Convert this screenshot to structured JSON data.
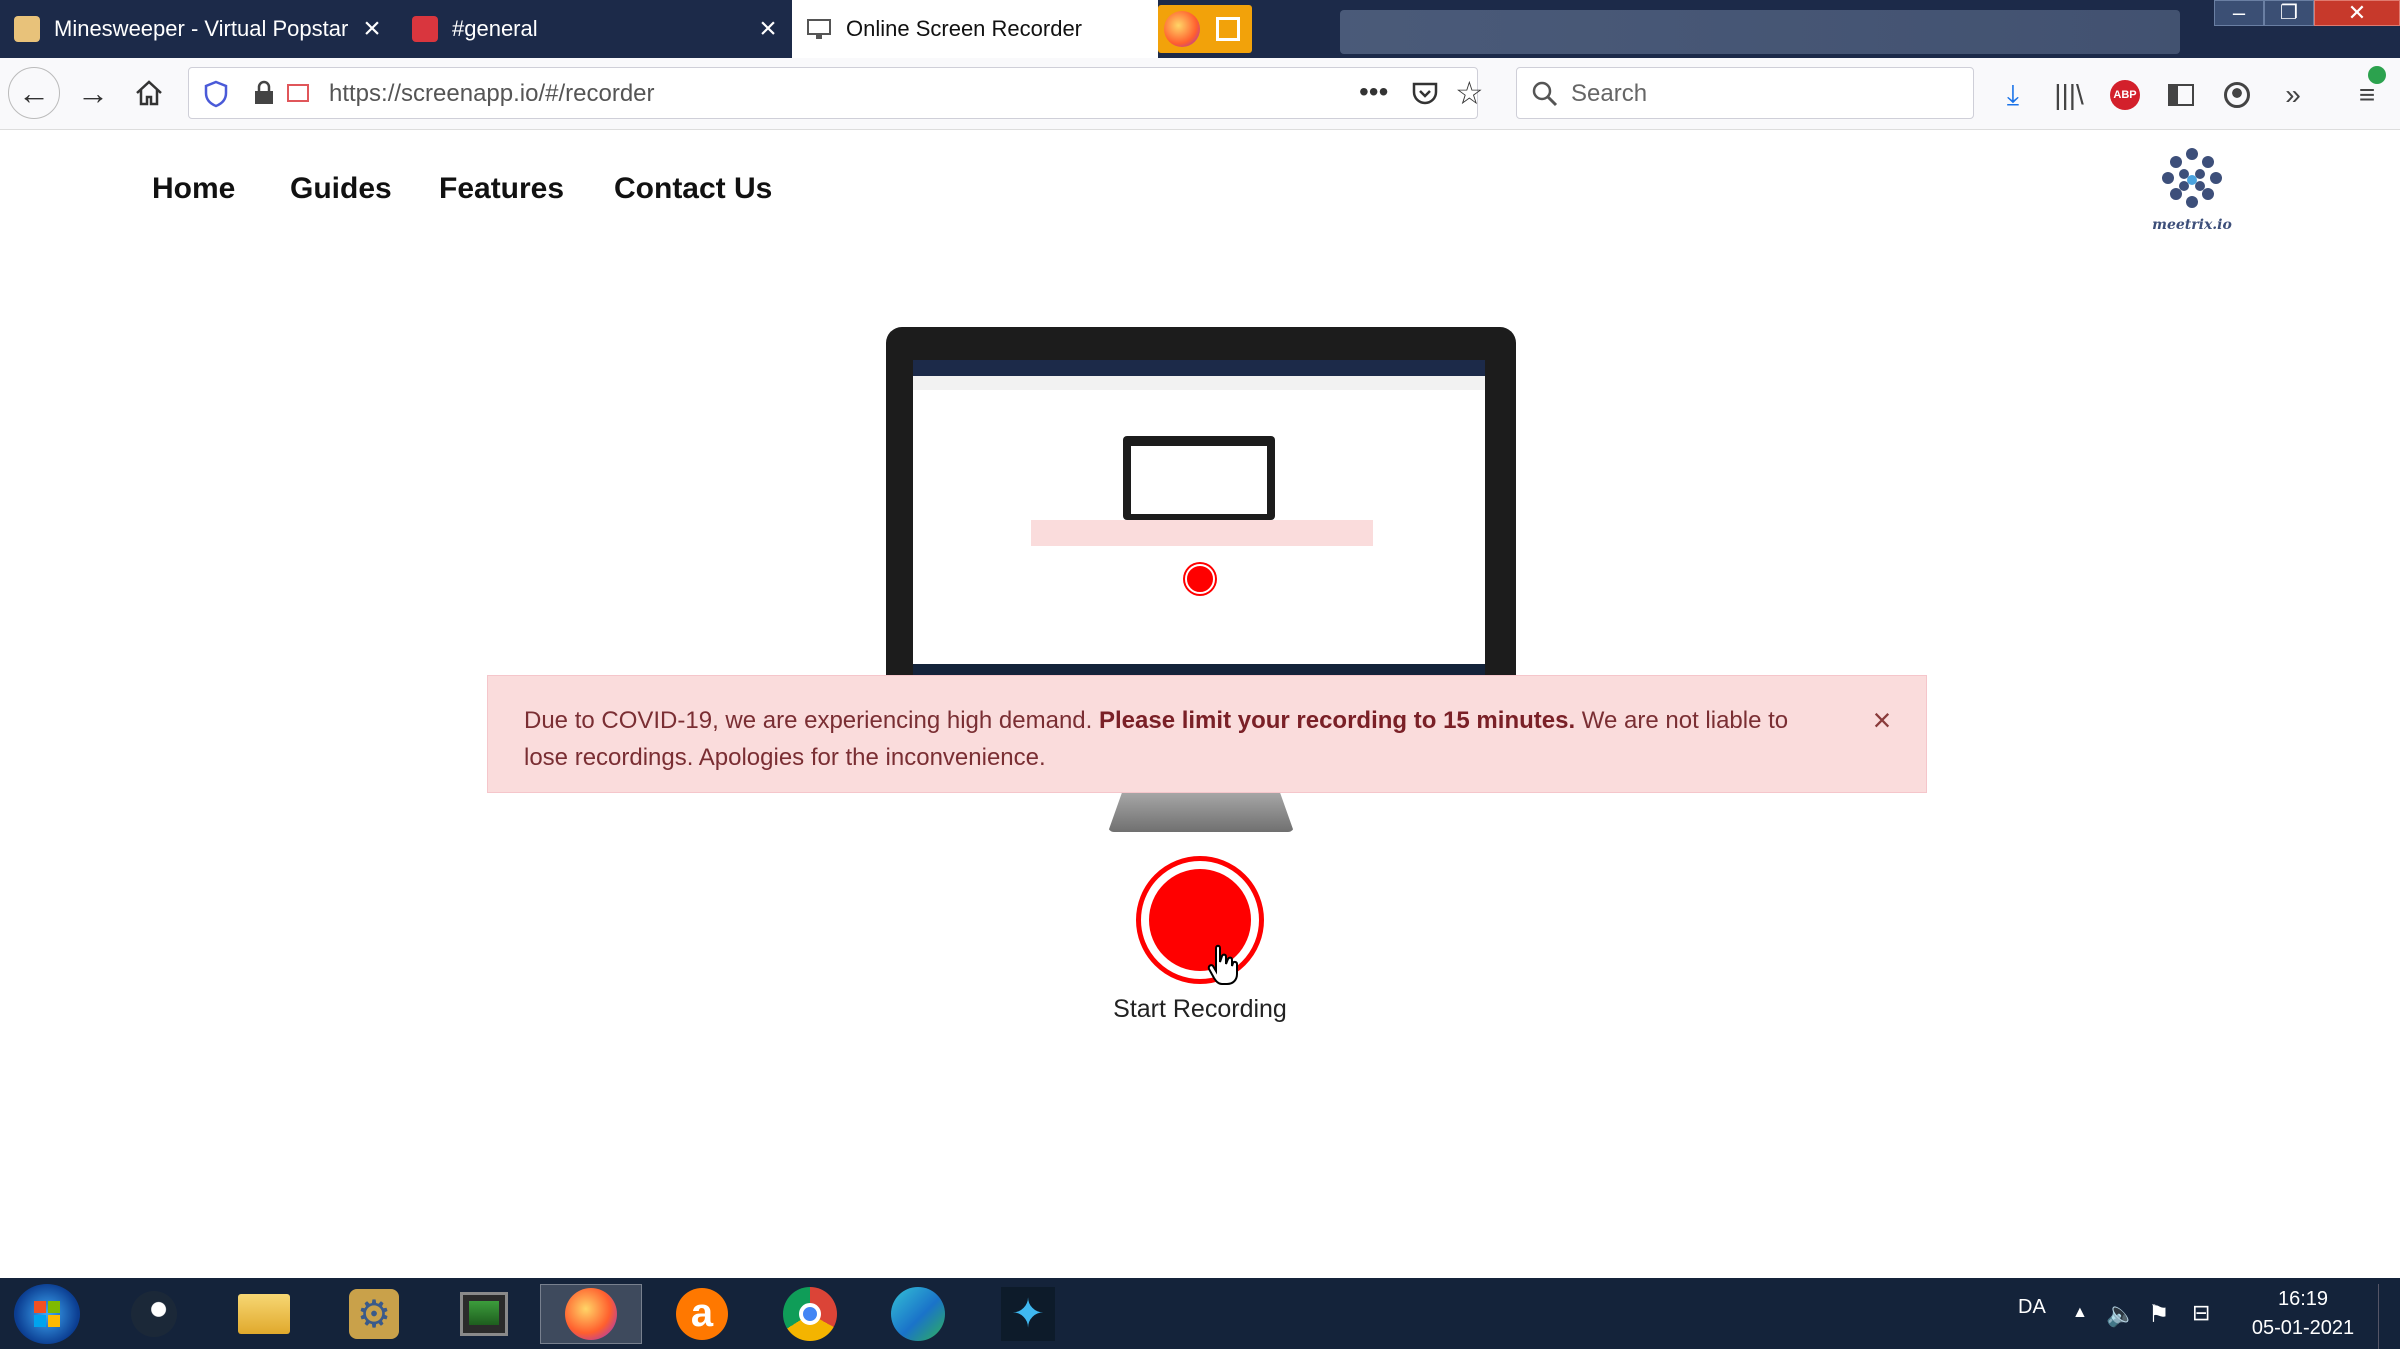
{
  "browser": {
    "tabs": [
      {
        "label": "Minesweeper - Virtual Popstar",
        "favicon": "minesweeper-favicon"
      },
      {
        "label": "#general",
        "favicon": "discord-favicon"
      },
      {
        "label": "Online Screen Recorder",
        "favicon": "monitor-favicon"
      }
    ],
    "url": "https://screenapp.io/#/recorder",
    "search_placeholder": "Search"
  },
  "site": {
    "nav": [
      "Home",
      "Guides",
      "Features",
      "Contact Us"
    ],
    "logo_text": "meetrix.io"
  },
  "alert": {
    "text_before": "Due to COVID-19, we are experiencing high demand. ",
    "text_bold": "Please limit your recording to 15 minutes.",
    "text_after": " We are not liable to lose recordings. Apologies for the inconvenience.",
    "close_symbol": "×"
  },
  "recorder": {
    "button_label": "Start Recording"
  },
  "taskbar": {
    "apps": [
      "start-orb",
      "steam",
      "file-explorer",
      "settings-gear",
      "terminal",
      "firefox",
      "avast",
      "chrome",
      "edge",
      "app-star"
    ],
    "language": "DA",
    "time": "16:19",
    "date": "05-01-2021"
  },
  "colors": {
    "accent_red": "#ff0000",
    "alert_bg": "#fadcdc",
    "tabbar": "#1c2a49",
    "taskbar": "#14233a"
  }
}
